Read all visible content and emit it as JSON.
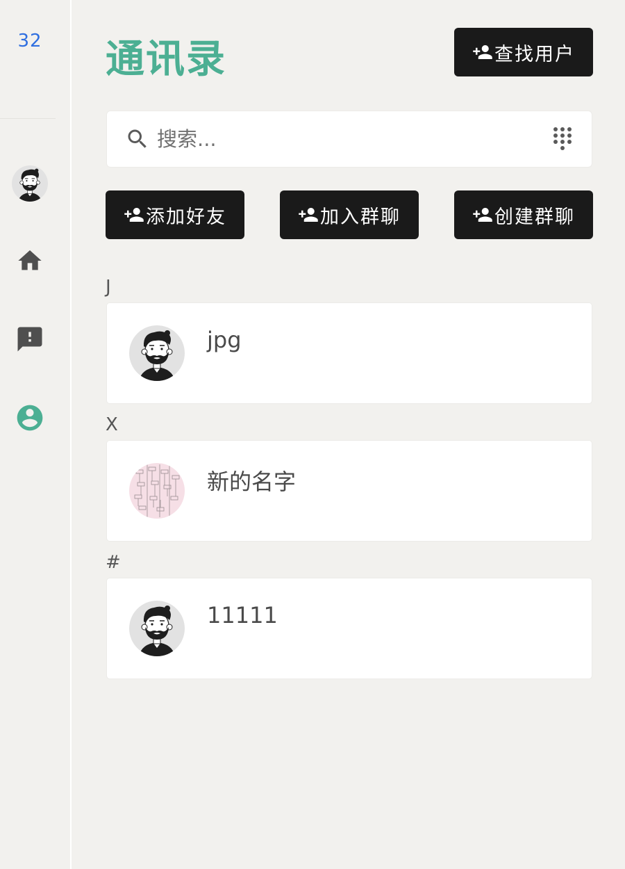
{
  "sidebar": {
    "counter": "32",
    "nav": [
      {
        "icon": "avatar"
      },
      {
        "icon": "home-icon"
      },
      {
        "icon": "feedback-icon"
      },
      {
        "icon": "account-circle-icon",
        "color": "#4caf93"
      }
    ]
  },
  "header": {
    "title": "通讯录",
    "title_color": "#4caf93",
    "find_user_label": "查找用户"
  },
  "search": {
    "placeholder": "搜索..."
  },
  "actions": {
    "add_friend_label": "添加好友",
    "join_group_label": "加入群聊",
    "create_group_label": "创建群聊"
  },
  "contacts": [
    {
      "letter": "J",
      "name": "jpg",
      "avatar": "cartoon-man"
    },
    {
      "letter": "X",
      "name": "新的名字",
      "avatar": "pink-diagram"
    },
    {
      "letter": "#",
      "name": "11111",
      "avatar": "cartoon-man"
    }
  ],
  "colors": {
    "background": "#f2f1ee",
    "button": "#1a1a1a",
    "accent": "#4caf93",
    "counter": "#2f6fe0"
  }
}
